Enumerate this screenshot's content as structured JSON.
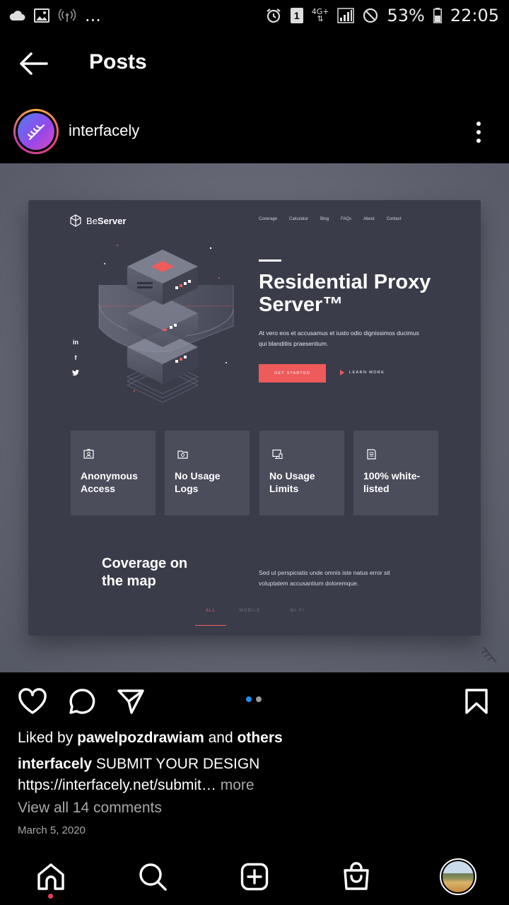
{
  "status_bar": {
    "battery_percent": "53%",
    "time": "22:05",
    "sim_slot": "1",
    "network": "4G+",
    "overflow": "..."
  },
  "header": {
    "title": "Posts"
  },
  "post": {
    "username": "interfacely",
    "image": {
      "logo_light": "Be",
      "logo_bold": "Server",
      "nav": [
        "Coverage",
        "Calculator",
        "Blog",
        "FAQs",
        "About",
        "Contact"
      ],
      "hero_title": "Residential Proxy Server™",
      "hero_desc": "At vero eos et accusamus et iusto odio dignissimos ducimus qui blanditiis praesentium.",
      "cta_label": "GET STARTED",
      "learn_more_label": "LEARN MORE",
      "social": [
        "in",
        "f",
        "t"
      ],
      "features": [
        {
          "label": "Anonymous Access",
          "icon": "id-card-icon"
        },
        {
          "label": "No Usage Logs",
          "icon": "folder-icon"
        },
        {
          "label": "No Usage Limits",
          "icon": "monitor-icon"
        },
        {
          "label": "100% white-listed",
          "icon": "list-icon"
        }
      ],
      "coverage_title": "Coverage on the map",
      "coverage_desc": "Sed ut perspiciatis unde omnis iste natus error sit voluptatem accusantium doloremque.",
      "coverage_tabs": [
        "ALL",
        "MOBILE",
        "WI-FI"
      ],
      "active_tab": "ALL"
    },
    "carousel": {
      "count": 2,
      "active_index": 0
    },
    "liked_by_prefix": "Liked by ",
    "liked_by_user": "pawelpozdrawiam",
    "liked_by_middle": " and ",
    "liked_by_others": "others",
    "caption_user": "interfacely",
    "caption_text": " SUBMIT YOUR DESIGN",
    "caption_link": "https://interfacely.net/submit…",
    "caption_more": " more",
    "view_comments": "View all 14 comments",
    "date": "March 5, 2020"
  },
  "colors": {
    "accent_red": "#ef5a5a",
    "carousel_active": "#1e8cf0",
    "carousel_inactive": "#9a9a9a",
    "notification_dot": "#ef3f5a"
  },
  "bottom_nav": [
    "home-icon",
    "search-icon",
    "new-post-icon",
    "shop-icon",
    "profile-avatar"
  ]
}
